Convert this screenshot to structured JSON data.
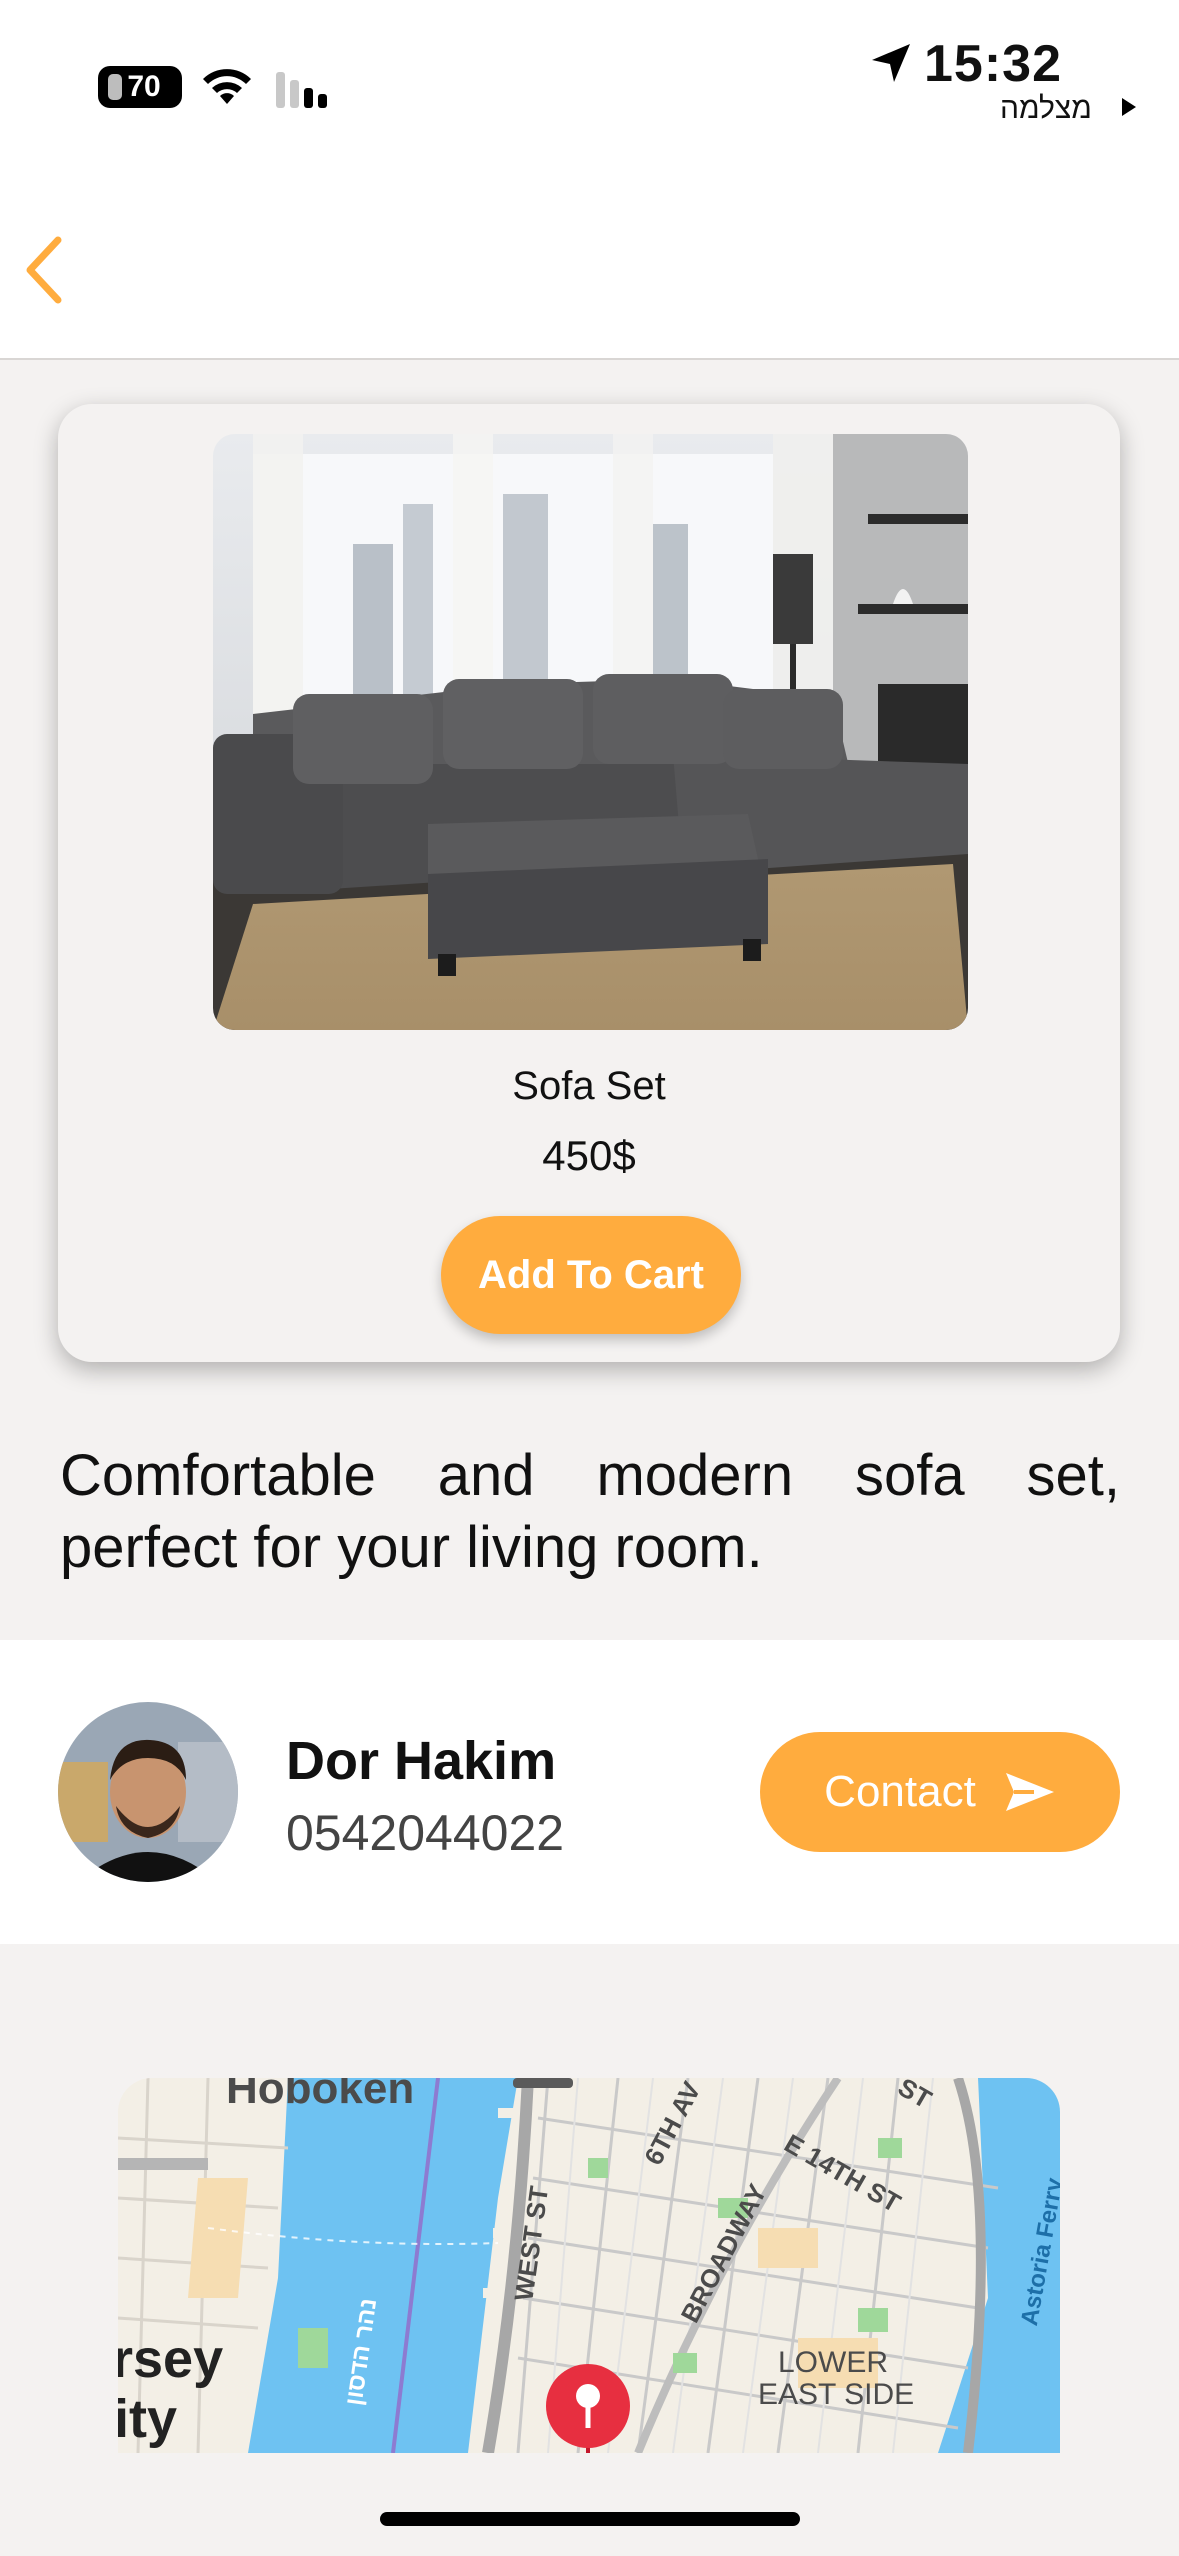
{
  "status_bar": {
    "battery_level": "70",
    "time": "15:32",
    "carrier_label": "מצלמה"
  },
  "product": {
    "name": "Sofa Set",
    "price": "450$",
    "add_to_cart_label": "Add To Cart",
    "description": "Comfortable and modern sofa set, perfect for your living room."
  },
  "seller": {
    "name": "Dor Hakim",
    "phone": "0542044022",
    "contact_label": "Contact"
  },
  "map": {
    "labels": {
      "hoboken": "Hoboken",
      "west_st": "WEST ST",
      "sixth_av": "6TH AV",
      "e14th_st": "E 14TH ST",
      "broadway": "BROADWAY",
      "lower": "LOWER",
      "east_side": "EAST SIDE",
      "jersey": "rsey",
      "city": "ity",
      "astoria_ferry": "Astoria Ferry",
      "hudson": "נהר הדסון",
      "st": "ST"
    }
  },
  "colors": {
    "accent": "#ffac3e",
    "background": "#f4f2f1",
    "water": "#6ec2f2",
    "map_land": "#f3efe6"
  },
  "icons": {
    "back": "chevron-left-icon",
    "send": "send-icon",
    "pin": "map-pin-icon"
  }
}
